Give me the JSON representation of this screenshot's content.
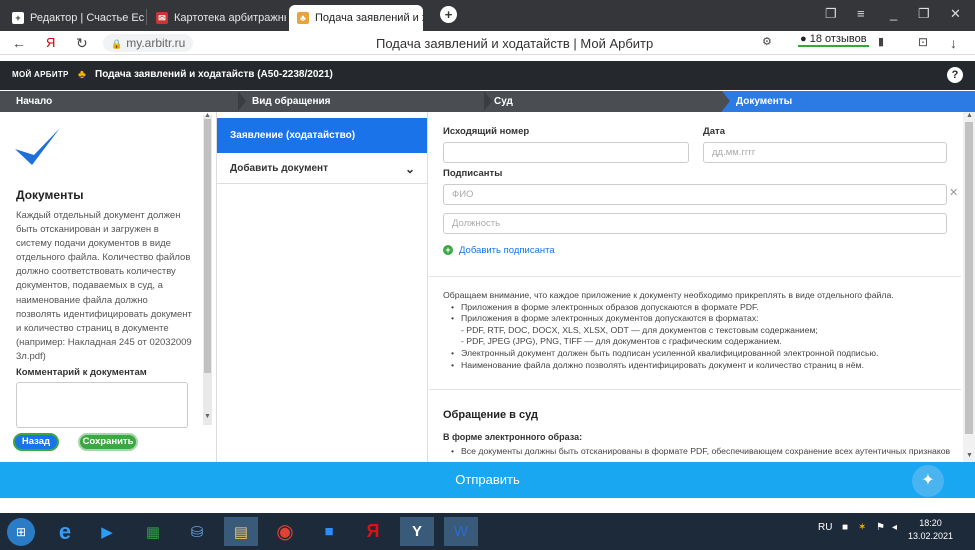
{
  "browser": {
    "tabs": [
      {
        "label": "Редактор | Счастье Есть! |",
        "icon": "plus-icon"
      },
      {
        "label": "Картотека арбитражных д",
        "icon": "mail-icon"
      },
      {
        "label": "Подача заявлений и хо",
        "icon": "arbitr-icon"
      }
    ],
    "new_tab": "+",
    "url": "my.arbitr.ru",
    "page_title": "Подача заявлений и ходатайств | Мой Арбитр",
    "reviews": "18 отзывов"
  },
  "app": {
    "logo": "МОЙ АРБИТР",
    "title": "Подача заявлений и ходатайств  (А50-2238/2021)",
    "help": "?"
  },
  "steps": [
    "Начало",
    "Вид обращения",
    "Суд",
    "Документы"
  ],
  "left": {
    "heading": "Документы",
    "text": "Каждый отдельный документ должен быть отсканирован и загружен в систему подачи документов в виде отдельного файла. Количество файлов должно соответствовать количеству документов, подаваемых в суд, а наименование файла должно позволять идентифицировать документ и количество страниц в документе (например: Накладная 245 от 02032009 3л.pdf)",
    "comment_label": "Комментарий к документам",
    "back": "Назад",
    "save": "Сохранить"
  },
  "middle": {
    "item1": "Заявление (ходатайство)",
    "item2": "Добавить документ"
  },
  "form": {
    "outgoing_label": "Исходящий номер",
    "date_label": "Дата",
    "date_placeholder": "дд.мм.гггг",
    "signers_label": "Подписанты",
    "fio_placeholder": "ФИО",
    "position_placeholder": "Должность",
    "add_signer": "Добавить подписанта",
    "info_intro": "Обращаем внимание, что каждое приложение к документу необходимо прикреплять в виде отдельного файла.",
    "info_b1": "Приложения в форме электронных образов допускаются в формате PDF.",
    "info_b2": "Приложения в форме электронных документов допускаются в форматах:",
    "info_s1": "- PDF, RTF, DOC, DOCX, XLS, XLSX, ODT — для документов с текстовым содержанием;",
    "info_s2": "- PDF, JPEG (JPG), PNG, TIFF — для документов с графическим содержанием.",
    "info_b3": "Электронный документ должен быть подписан усиленной квалифицированной электронной подписью.",
    "info_b4": "Наименование файла должно позволять идентифицировать документ и количество страниц в нём.",
    "appeal_heading": "Обращение в суд",
    "electronic_label": "В форме электронного образа:",
    "electronic_item": "Все документы должны быть отсканированы в формате PDF, обеспечивающем сохранение всех аутентичных признаков"
  },
  "send": "Отправить",
  "taskbar": {
    "lang": "RU",
    "time": "18:20",
    "date": "13.02.2021"
  }
}
